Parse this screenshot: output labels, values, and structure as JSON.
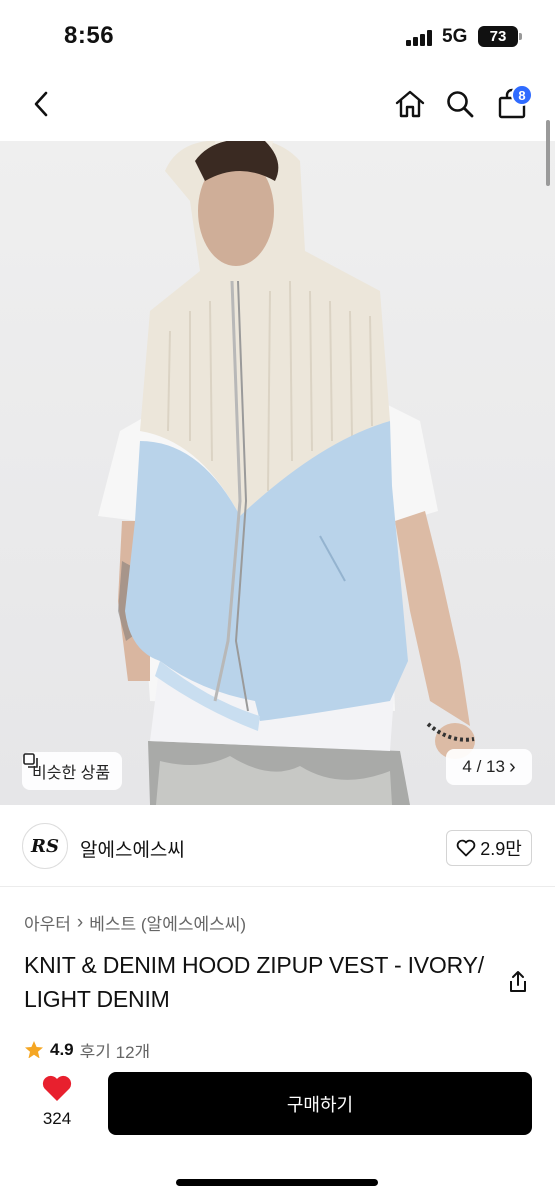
{
  "status_bar": {
    "time": "8:56",
    "network": "5G",
    "battery": "73"
  },
  "nav": {
    "back_icon": "chevron-left",
    "home_icon": "home",
    "search_icon": "search",
    "cart_icon": "shopping-bag",
    "cart_badge": "8"
  },
  "gallery": {
    "similar_label": "비슷한 상품",
    "counter": "4 / 13",
    "counter_arrow": "›"
  },
  "brand": {
    "logo_text": "RS",
    "name": "알에스에스씨",
    "likes": "2.9만"
  },
  "breadcrumb": {
    "level1": "아우터",
    "separator": "›",
    "level2": "베스트 (알에스에스씨)"
  },
  "product": {
    "title": "KNIT & DENIM HOOD ZIPUP VEST - IVORY/LIGHT DENIM",
    "rating": "4.9",
    "review_label": "후기 12개"
  },
  "bottom_bar": {
    "wish_count": "324",
    "buy_label": "구매하기"
  },
  "colors": {
    "accent_badge": "#2f6bff",
    "heart": "#e8202e",
    "star": "#f5a623",
    "buy_button": "#000000"
  }
}
